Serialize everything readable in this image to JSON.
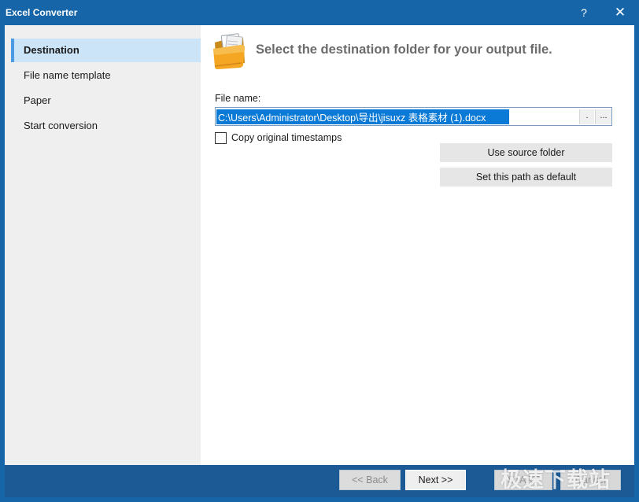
{
  "window": {
    "title": "Excel Converter",
    "help_glyph": "?",
    "close_glyph": "✕"
  },
  "sidebar": {
    "items": [
      {
        "label": "Destination",
        "active": true
      },
      {
        "label": "File name template",
        "active": false
      },
      {
        "label": "Paper",
        "active": false
      },
      {
        "label": "Start conversion",
        "active": false
      }
    ]
  },
  "main": {
    "heading": "Select the destination folder for your output file.",
    "file_name_label": "File name:",
    "file_path": "C:\\Users\\Administrator\\Desktop\\导出\\jisuxz 表格素材 (1).docx",
    "path_btn_dot": ".",
    "path_btn_more": "...",
    "copy_timestamps_label": "Copy original timestamps",
    "copy_timestamps_checked": false,
    "use_source_folder_label": "Use source folder",
    "set_default_label": "Set this path as default"
  },
  "footer": {
    "back_label": "<< Back",
    "next_label": "Next >>",
    "start_label": "START",
    "cancel_label": "Cancel"
  },
  "watermark": {
    "text": "极速下载站"
  },
  "colors": {
    "titlebar": "#1565a8",
    "footer": "#1c5a96",
    "sidebar_active": "#cce4f7",
    "selection": "#0a7ad6"
  }
}
